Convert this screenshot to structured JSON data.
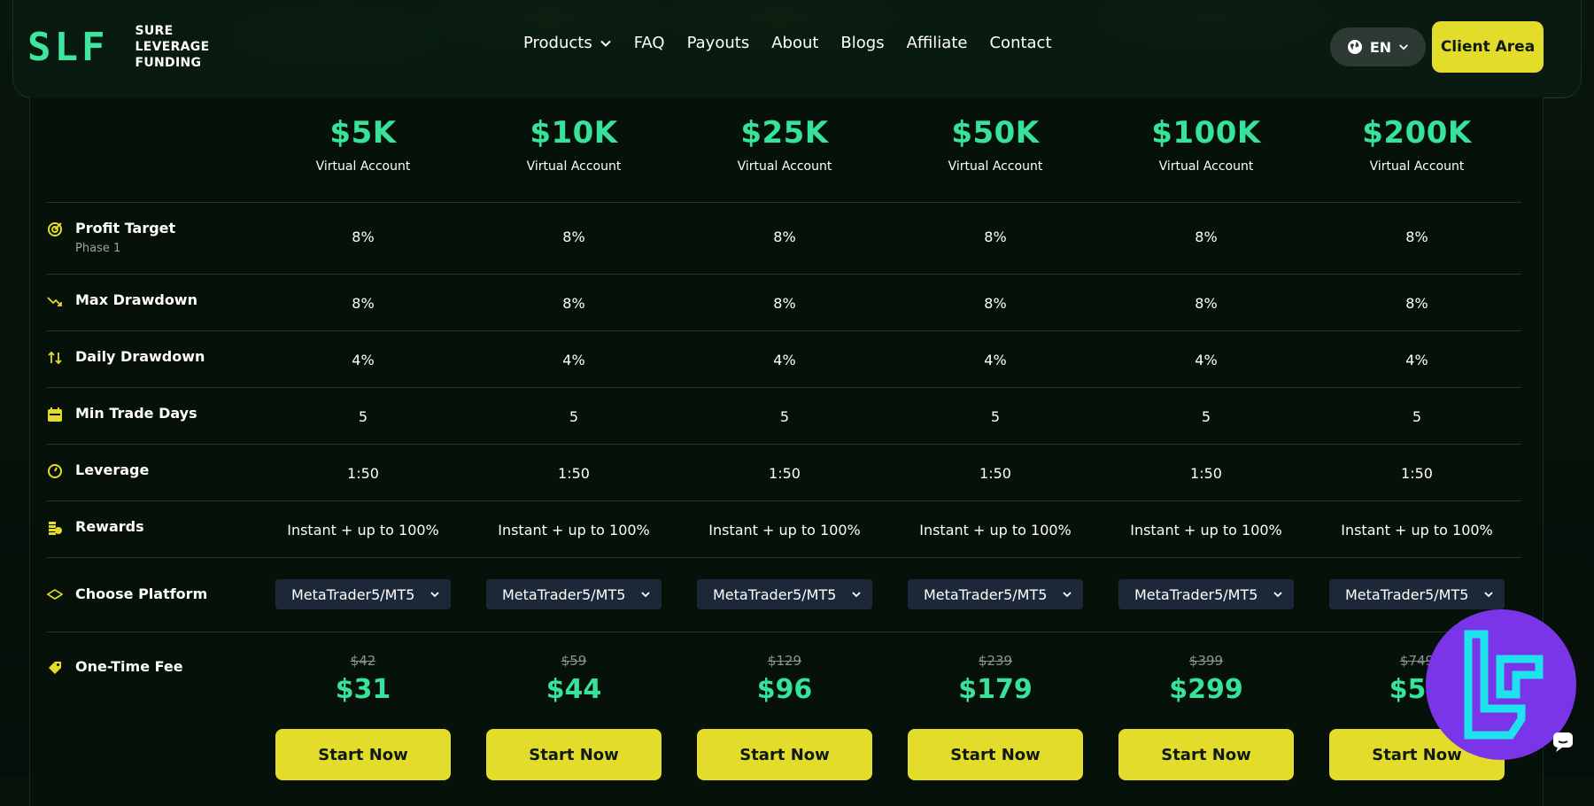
{
  "brand": {
    "mark": "SLF",
    "name_lines": [
      "SURE",
      "LEVERAGE",
      "FUNDING"
    ]
  },
  "nav": [
    {
      "label": "Products",
      "has_dropdown": true
    },
    {
      "label": "FAQ"
    },
    {
      "label": "Payouts"
    },
    {
      "label": "About"
    },
    {
      "label": "Blogs"
    },
    {
      "label": "Affiliate"
    },
    {
      "label": "Contact"
    }
  ],
  "language": {
    "label": "EN",
    "icon": "globe-icon"
  },
  "client_area_label": "Client Area",
  "colors": {
    "accent_green": "#37e29a",
    "accent_yellow": "#e3dc2a",
    "watermark_purple": "#7b35e8",
    "watermark_cyan": "#1ee3ee"
  },
  "plans": [
    {
      "amount": "$5K",
      "sub": "Virtual Account",
      "profit_target": "8%",
      "max_drawdown": "8%",
      "daily_drawdown": "4%",
      "min_trade_days": "5",
      "leverage": "1:50",
      "rewards": "Instant + up to 100%",
      "platform": "MetaTrader5/MT5",
      "old_price": "$42",
      "price": "$31",
      "cta": "Start Now"
    },
    {
      "amount": "$10K",
      "sub": "Virtual Account",
      "profit_target": "8%",
      "max_drawdown": "8%",
      "daily_drawdown": "4%",
      "min_trade_days": "5",
      "leverage": "1:50",
      "rewards": "Instant + up to 100%",
      "platform": "MetaTrader5/MT5",
      "old_price": "$59",
      "price": "$44",
      "cta": "Start Now"
    },
    {
      "amount": "$25K",
      "sub": "Virtual Account",
      "profit_target": "8%",
      "max_drawdown": "8%",
      "daily_drawdown": "4%",
      "min_trade_days": "5",
      "leverage": "1:50",
      "rewards": "Instant + up to 100%",
      "platform": "MetaTrader5/MT5",
      "old_price": "$129",
      "price": "$96",
      "cta": "Start Now"
    },
    {
      "amount": "$50K",
      "sub": "Virtual Account",
      "profit_target": "8%",
      "max_drawdown": "8%",
      "daily_drawdown": "4%",
      "min_trade_days": "5",
      "leverage": "1:50",
      "rewards": "Instant + up to 100%",
      "platform": "MetaTrader5/MT5",
      "old_price": "$239",
      "price": "$179",
      "cta": "Start Now"
    },
    {
      "amount": "$100K",
      "sub": "Virtual Account",
      "profit_target": "8%",
      "max_drawdown": "8%",
      "daily_drawdown": "4%",
      "min_trade_days": "5",
      "leverage": "1:50",
      "rewards": "Instant + up to 100%",
      "platform": "MetaTrader5/MT5",
      "old_price": "$399",
      "price": "$299",
      "cta": "Start Now"
    },
    {
      "amount": "$200K",
      "sub": "Virtual Account",
      "profit_target": "8%",
      "max_drawdown": "8%",
      "daily_drawdown": "4%",
      "min_trade_days": "5",
      "leverage": "1:50",
      "rewards": "Instant + up to 100%",
      "platform": "MetaTrader5/MT5",
      "old_price": "$749",
      "price": "$56",
      "cta": "Start Now"
    }
  ],
  "rows": {
    "profit_target": {
      "label": "Profit Target",
      "sub": "Phase 1",
      "icon": "target-icon"
    },
    "max_drawdown": {
      "label": "Max Drawdown",
      "icon": "trend-down-icon"
    },
    "daily_drawdown": {
      "label": "Daily Drawdown",
      "icon": "arrows-up-down-icon"
    },
    "min_trade_days": {
      "label": "Min Trade Days",
      "icon": "calendar-icon"
    },
    "leverage": {
      "label": "Leverage",
      "icon": "gauge-icon"
    },
    "rewards": {
      "label": "Rewards",
      "icon": "coins-icon"
    },
    "platform": {
      "label": "Choose Platform",
      "icon": "layers-icon"
    },
    "fee": {
      "label": "One-Time Fee",
      "icon": "tag-icon"
    }
  }
}
